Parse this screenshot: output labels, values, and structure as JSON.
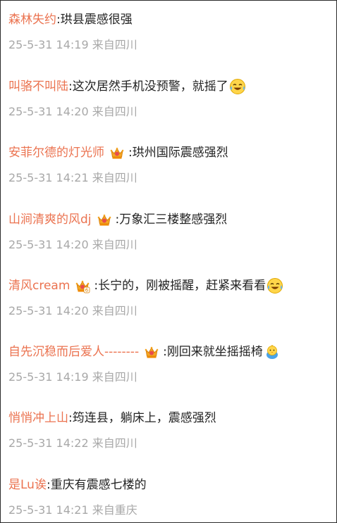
{
  "comments": [
    {
      "user": "森林失约",
      "colon": ":",
      "text": "珙县震感很强",
      "time": "25-5-31 14:19",
      "location": "来自四川",
      "badge": false,
      "emoji": null
    },
    {
      "user": "叫骆不叫陆",
      "colon": ":",
      "text": "这次居然手机没预警，就摇了",
      "time": "25-5-31 14:20",
      "location": "来自四川",
      "badge": false,
      "emoji": "laugh-cry-icon"
    },
    {
      "user": "安菲尔德的灯光师",
      "colon": ":",
      "text": "珙州国际震感强烈",
      "time": "25-5-31 14:21",
      "location": "来自四川",
      "badge": true,
      "emoji": null
    },
    {
      "user": "山涧清爽的风dj",
      "colon": ":",
      "text": "万象汇三楼整感强烈",
      "time": "25-5-31 14:20",
      "location": "来自四川",
      "badge": true,
      "emoji": null
    },
    {
      "user": "清风cream",
      "colon": ":",
      "text": "长宁的，刚被摇醒，赶紧来看看",
      "time": "25-5-31 14:20",
      "location": "来自四川",
      "badge": true,
      "badge_level": "6",
      "emoji": "laugh-cry-icon"
    },
    {
      "user": "自先沉稳而后爱人--------",
      "colon": ":",
      "text": "刚回来就坐摇摇椅",
      "time": "25-5-31 14:19",
      "location": "来自四川",
      "badge": true,
      "emoji": "baby-chick-icon"
    },
    {
      "user": "悄悄冲上山",
      "colon": ":",
      "text": "筠连县，躺床上，震感强烈",
      "time": "25-5-31 14:22",
      "location": "来自四川",
      "badge": false,
      "emoji": null
    },
    {
      "user": "是Lu诶",
      "colon": ":",
      "text": "重庆有震感七楼的",
      "time": "25-5-31 14:21",
      "location": "来自重庆",
      "badge": false,
      "emoji": null
    }
  ],
  "colors": {
    "username": "#eb7350",
    "text": "#222222",
    "meta": "#a8a8a8",
    "crown": "#f5a623"
  }
}
